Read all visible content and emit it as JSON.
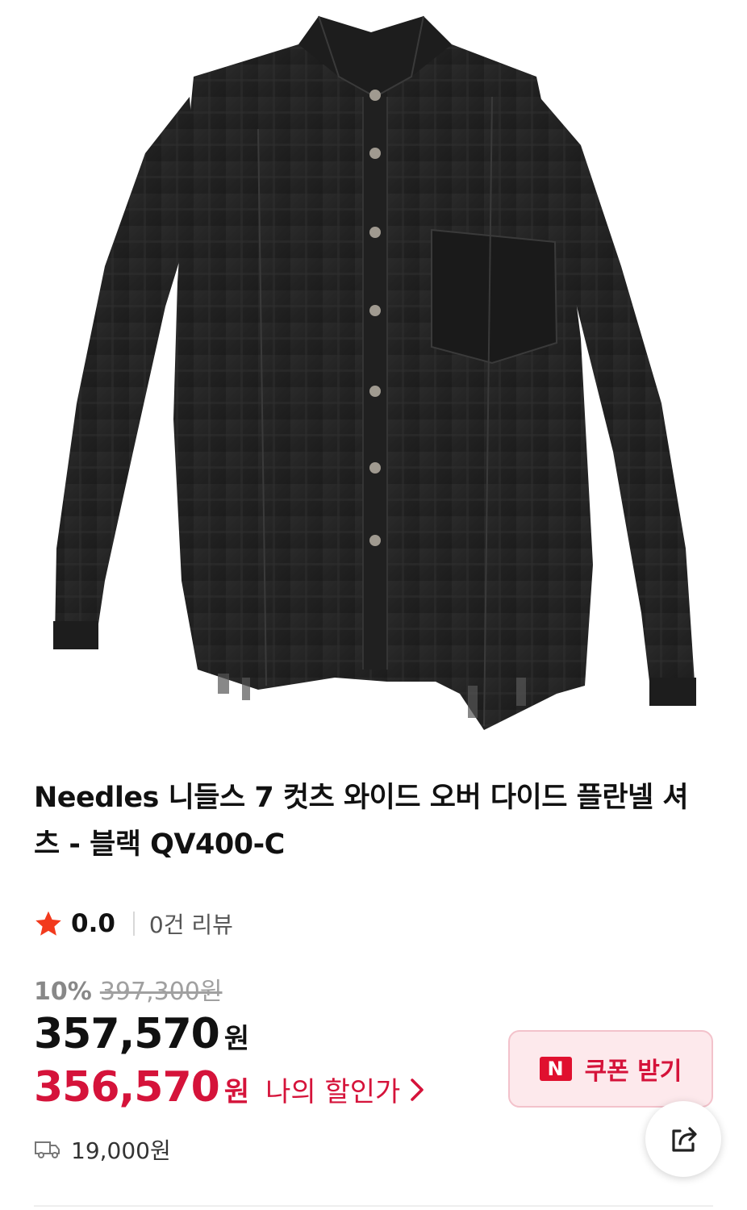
{
  "product": {
    "image_alt": "블랙 플란넬 셔츠",
    "title": "Needles 니들스 7 컷츠 와이드 오버 다이드 플란넬 셔츠 - 블랙 QV400-C"
  },
  "rating": {
    "icon": "star-icon",
    "value": "0.0",
    "review_count": "0건 리뷰",
    "star_color": "#f23a1d"
  },
  "price": {
    "discount_rate": "10%",
    "original_price": "397,300원",
    "sale_price": "357,570",
    "sale_currency": "원",
    "my_price": "356,570",
    "my_currency": "원",
    "my_discount_label": "나의 할인가",
    "accent_color": "#d5133a"
  },
  "coupon": {
    "badge": "N",
    "label": "쿠폰 받기"
  },
  "share": {
    "icon": "share-icon"
  },
  "shipping": {
    "icon": "truck-icon",
    "fee": "19,000원"
  }
}
